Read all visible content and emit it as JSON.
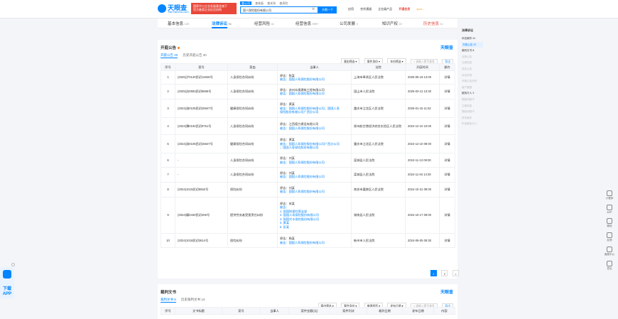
{
  "header": {
    "logo_text": "天眼查",
    "logo_sub": "TianYancha.com",
    "banner_lines": [
      "国家中小企业发展基金旗下",
      "官方备案企业征信机构"
    ],
    "search_tabs": [
      "查公司",
      "查老板",
      "查关系",
      "查风险"
    ],
    "search_value": "国人保险股份有限公司",
    "search_button": "天眼一下",
    "nav": [
      "应用",
      "合作通道",
      "企业级产品",
      "开通会员",
      "tyc4..."
    ]
  },
  "tabs": [
    {
      "label": "基本信息",
      "count": "120"
    },
    {
      "label": "法律诉讼",
      "count": "91"
    },
    {
      "label": "经营风险",
      "count": "41"
    },
    {
      "label": "经营信息",
      "count": "999+"
    },
    {
      "label": "公司发展",
      "count": "3"
    },
    {
      "label": "知识产权",
      "count": "22"
    },
    {
      "label": "历史信息",
      "count": "11"
    }
  ],
  "section1": {
    "title": "开庭公告",
    "brand": "天眼查",
    "subtab_active": "开庭公告 20",
    "subtab_other": "历史开庭公告 20",
    "filters": [
      "案由筛选",
      "案件身份",
      "年份筛选"
    ],
    "search_placeholder": "请输入案号查找",
    "export": "导出",
    "columns": [
      "序号",
      "案号",
      "案由",
      "当事人",
      "法院",
      "开庭时间",
      "操作"
    ],
    "rows": [
      {
        "no": "1",
        "case": "(2025)沪0120民初12846号",
        "cause": "人身保险合同纠纷",
        "parties": [
          "原告：陈某",
          "被告：国国人寿保险股份有限公司"
        ],
        "court": "上海市奉贤区人民法院",
        "time": "2025-05-19 14:00",
        "op": "详情"
      },
      {
        "no": "2",
        "case": "(2025)苏0583民初8686号",
        "cause": "人身保险合同纠纷",
        "parties": [
          "原告：苏州众焕建筑工程有限公司",
          "被告：国国人寿保险股份有限公司"
        ],
        "court": "昆山市人民法院",
        "time": "2025-03-12 13:30",
        "op": "详情"
      },
      {
        "no": "3",
        "case": "(2024)渝0105民初25847号",
        "cause": "健康保险合同纠纷",
        "parties": [
          "原告：黄某",
          "被告：国国人寿保险股份有限公司；国国人寿",
          "保险股份有限公司广西分公司"
        ],
        "court": "重庆市江北区人民法院",
        "time": "2025-01-15 11:52",
        "op": "详情"
      },
      {
        "no": "4",
        "case": "(2024)豫0192民初9751号",
        "cause": "人身保险合同纠纷",
        "parties": [
          "原告：江西德力建设有限公司",
          "被告：国国人寿保险股份有限公司"
        ],
        "court": "郑州航空港经济综合实验区人民法院",
        "time": "2024-12-10 10:00",
        "op": "详情"
      },
      {
        "no": "5",
        "case": "(2024)渝0105民初25847号",
        "cause": "健康保险合同纠纷",
        "parties": [
          "原告：黄某",
          "被告：国国人寿保险股份有限公司广西分公司",
          "；国国人寿保险股份有限公司"
        ],
        "court": "重庆市江北区人民法院",
        "time": "2024-12-10 09:00",
        "op": "详情"
      },
      {
        "no": "6",
        "case": "-",
        "cause": "人身保险合同纠纷",
        "parties": [
          "原告：刘某",
          "被告：国国人寿保险股份有限公司"
        ],
        "court": "栾城县人民法院",
        "time": "2024-11-13 09:00",
        "op": "详情"
      },
      {
        "no": "7",
        "case": "-",
        "cause": "人身保险合同纠纷",
        "parties": [
          "原告：刘某",
          "被告：国国人寿保险股份有限公司"
        ],
        "court": "栾城县人民法院",
        "time": "2024-11-04 14:30",
        "op": "详情"
      },
      {
        "no": "8",
        "case": "(2024)1015民初5552号",
        "cause": "保险纠纷",
        "parties": [
          "原告：刘某",
          "被告：国国人寿保险股份有限公司"
        ],
        "court": "南充市嘉陵区人民法院",
        "time": "2024-10-31 09:00",
        "op": "详情"
      },
      {
        "no": "9",
        "case": "(2024)赣0430民初406号",
        "cause": "提供劳务者受害责任纠纷",
        "parties": [
          "原告：宋某",
          "被告：",
          "1. 国国财保险营业部",
          "2. 国国人寿保险股份有限公司",
          "3. 国国大丰保险股份有限公司",
          "4. 黄某",
          "5. 彭某"
        ],
        "court": "湖南县人民法院",
        "time": "2024-10-17 09:00",
        "op": "详情"
      },
      {
        "no": "10",
        "case": "(2024)1018民初3614号",
        "cause": "保险纠纷",
        "parties": [
          "原告：杨某",
          "被告：国国人寿保险股份有限公司"
        ],
        "court": "新州市人民法院",
        "time": "2024-09-05 09:30",
        "op": "详情"
      }
    ],
    "pages": [
      "1",
      "2",
      ">"
    ]
  },
  "section2": {
    "title": "裁判文书",
    "brand": "天眼查",
    "subtab_active": "裁判文书 8",
    "subtab_other": "历史裁判文书 13",
    "filters": [
      "案由筛选",
      "案件身份",
      "审理程序",
      "发布日期"
    ],
    "search_placeholder": "请输入案号查找",
    "export": "导出",
    "columns": [
      "序号",
      "文书标题",
      "案号",
      "当事人",
      "案件金额(元)",
      "案件判决",
      "裁判日期",
      "发布日期",
      "内容"
    ]
  },
  "sidemenu": {
    "header": "法律诉讼",
    "items": [
      "司法案件 41",
      "开庭公告 20",
      "裁判文书 8",
      "法院公告",
      "立案信息",
      "送达公告",
      "诉讼时效",
      "开庭公告历史",
      "破产重整",
      "被执行人 3",
      "限制消费令",
      "立案信息",
      "限制消费令",
      "终本案件",
      "失信被执行人"
    ]
  },
  "rightbar": [
    "小程序",
    "APP",
    "微信",
    "反馈",
    "客服中心",
    "意见"
  ],
  "app_ad": "下载 APP"
}
